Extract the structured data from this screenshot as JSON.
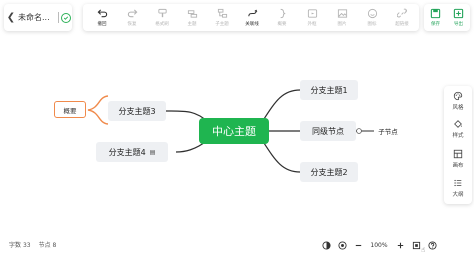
{
  "file": {
    "title": "未命名..."
  },
  "toolbar": {
    "undo": "撤回",
    "redo": "恢复",
    "format_painter": "格式刷",
    "topic": "主题",
    "subtopic": "子主题",
    "relation": "关联线",
    "summary": "概要",
    "frame": "外框",
    "image": "图片",
    "icon": "图标",
    "hyperlink": "超链接"
  },
  "actions": {
    "save": "保存",
    "export": "导出"
  },
  "mindmap": {
    "center": "中心主题",
    "branches": {
      "b1": "分支主题1",
      "b2": "分支主题2",
      "b3": "分支主题3",
      "b4": "分支主题4",
      "sibling": "同级节点"
    },
    "child": "子节点",
    "summary": "概要"
  },
  "side_panel": {
    "style": "风格",
    "format": "样式",
    "canvas": "画布",
    "outline": "大纲"
  },
  "status": {
    "word_label": "字数",
    "word_count": "33",
    "node_label": "节点",
    "node_count": "8",
    "zoom": "100%"
  },
  "colors": {
    "accent": "#1fb550",
    "summary_border": "#f08a4b"
  }
}
